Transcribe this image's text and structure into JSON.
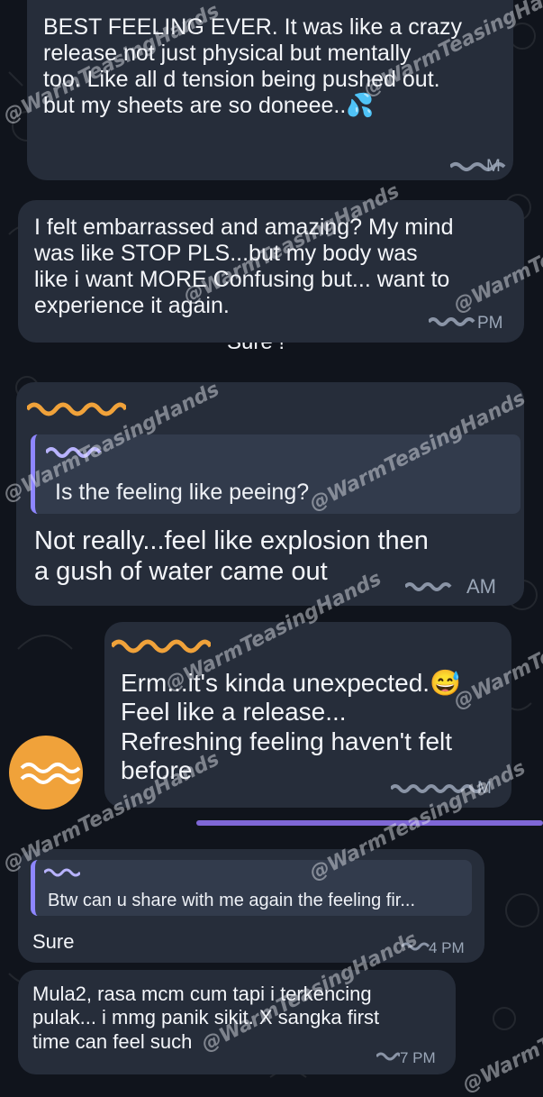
{
  "messages": [
    {
      "text_lines": [
        "BEST FEELING EVER. It was like a crazy",
        "release not just physical but mentally",
        "too. Like all d tension being pushed out.",
        "but my sheets are so doneee..💦"
      ],
      "time": "M"
    },
    {
      "text_lines": [
        "I felt embarrassed and amazing? My mind",
        "was like STOP PLS...but my body was",
        "like i want MORE Confusing but... want to",
        "experience it again."
      ],
      "time": "PM"
    },
    {
      "quote_text": "Is the feeling like peeing?",
      "text_lines": [
        "Not really...feel like explosion then",
        "a gush of water came out"
      ],
      "time": "AM"
    },
    {
      "text_lines": [
        "Erm...it's kinda unexpected.😅",
        "Feel like a release...",
        "Refreshing feeling haven't felt",
        "before"
      ],
      "time": "M"
    },
    {
      "quote_text": "Btw can u share with me again the feeling fir...",
      "text_lines": [
        "Sure"
      ],
      "time": "4 PM"
    },
    {
      "text_lines": [
        "Mula2, rasa mcm cum tapi i terkencing",
        "pulak... i mmg panik sikit. X sangka first",
        "time can feel such"
      ],
      "time": "7 PM"
    }
  ],
  "partial_text": "Sure !",
  "watermark": "@WarmTeasingHands",
  "colors": {
    "background": "#10141c",
    "bubble": "#262d3a",
    "quote_bar": "#8e86ff",
    "divider": "#7f67d6",
    "avatar": "#f0a23a"
  }
}
